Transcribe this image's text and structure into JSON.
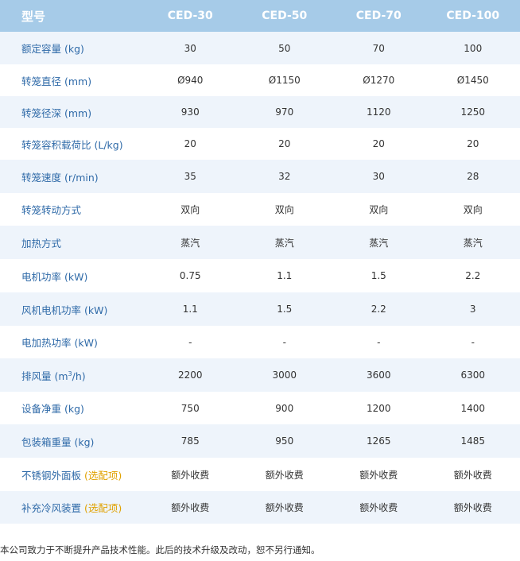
{
  "table": {
    "header": [
      "型号",
      "CED-30",
      "CED-50",
      "CED-70",
      "CED-100"
    ],
    "rows": [
      {
        "label": "额定容量 (kg)",
        "values": [
          "30",
          "50",
          "70",
          "100"
        ],
        "h": 41
      },
      {
        "label": "转笼直径 (mm)",
        "values": [
          "Ø940",
          "Ø1150",
          "Ø1270",
          "Ø1450"
        ],
        "h": 40
      },
      {
        "label": "转笼径深 (mm)",
        "values": [
          "930",
          "970",
          "1120",
          "1250"
        ],
        "h": 40
      },
      {
        "label": "转笼容积载荷比 (L/kg)",
        "values": [
          "20",
          "20",
          "20",
          "20"
        ],
        "h": 40
      },
      {
        "label": "转笼速度 (r/min)",
        "values": [
          "35",
          "32",
          "30",
          "28"
        ],
        "h": 42
      },
      {
        "label": "转笼转动方式",
        "values": [
          "双向",
          "双向",
          "双向",
          "双向"
        ],
        "h": 41
      },
      {
        "label": "加热方式",
        "values": [
          "蒸汽",
          "蒸汽",
          "蒸汽",
          "蒸汽"
        ],
        "h": 42
      },
      {
        "label": "电机功率 (kW)",
        "values": [
          "0.75",
          "1.1",
          "1.5",
          "2.2"
        ],
        "h": 42
      },
      {
        "label": "风机电机功率 (kW)",
        "values": [
          "1.1",
          "1.5",
          "2.2",
          "3"
        ],
        "h": 42
      },
      {
        "label": "电加热功率 (kW)",
        "values": [
          "-",
          "-",
          "-",
          "-"
        ],
        "h": 41
      },
      {
        "label_prefix": "排风量 (m",
        "label_sup": "3",
        "label_suffix": "/h)",
        "values": [
          "2200",
          "3000",
          "3600",
          "6300"
        ],
        "h": 42
      },
      {
        "label": "设备净重 (kg)",
        "values": [
          "750",
          "900",
          "1200",
          "1400"
        ],
        "h": 41
      },
      {
        "label": "包装箱重量 (kg)",
        "values": [
          "785",
          "950",
          "1265",
          "1485"
        ],
        "h": 42
      },
      {
        "label": "不锈钢外面板",
        "label_option": "(选配项)",
        "values": [
          "额外收费",
          "额外收费",
          "额外收费",
          "额外收费"
        ],
        "h": 42
      },
      {
        "label": "补充冷风装置",
        "label_option": "(选配项)",
        "values": [
          "额外收费",
          "额外收费",
          "额外收费",
          "额外收费"
        ],
        "h": 41
      }
    ]
  },
  "footnote": "本公司致力于不断提升产品技术性能。此后的技术升级及改动，恕不另行通知。",
  "colors": {
    "header_bg": "#a6cbe8",
    "label_blue": "#2f6aa8",
    "option_orange": "#e0a100",
    "stripe": "#eef4fb"
  }
}
